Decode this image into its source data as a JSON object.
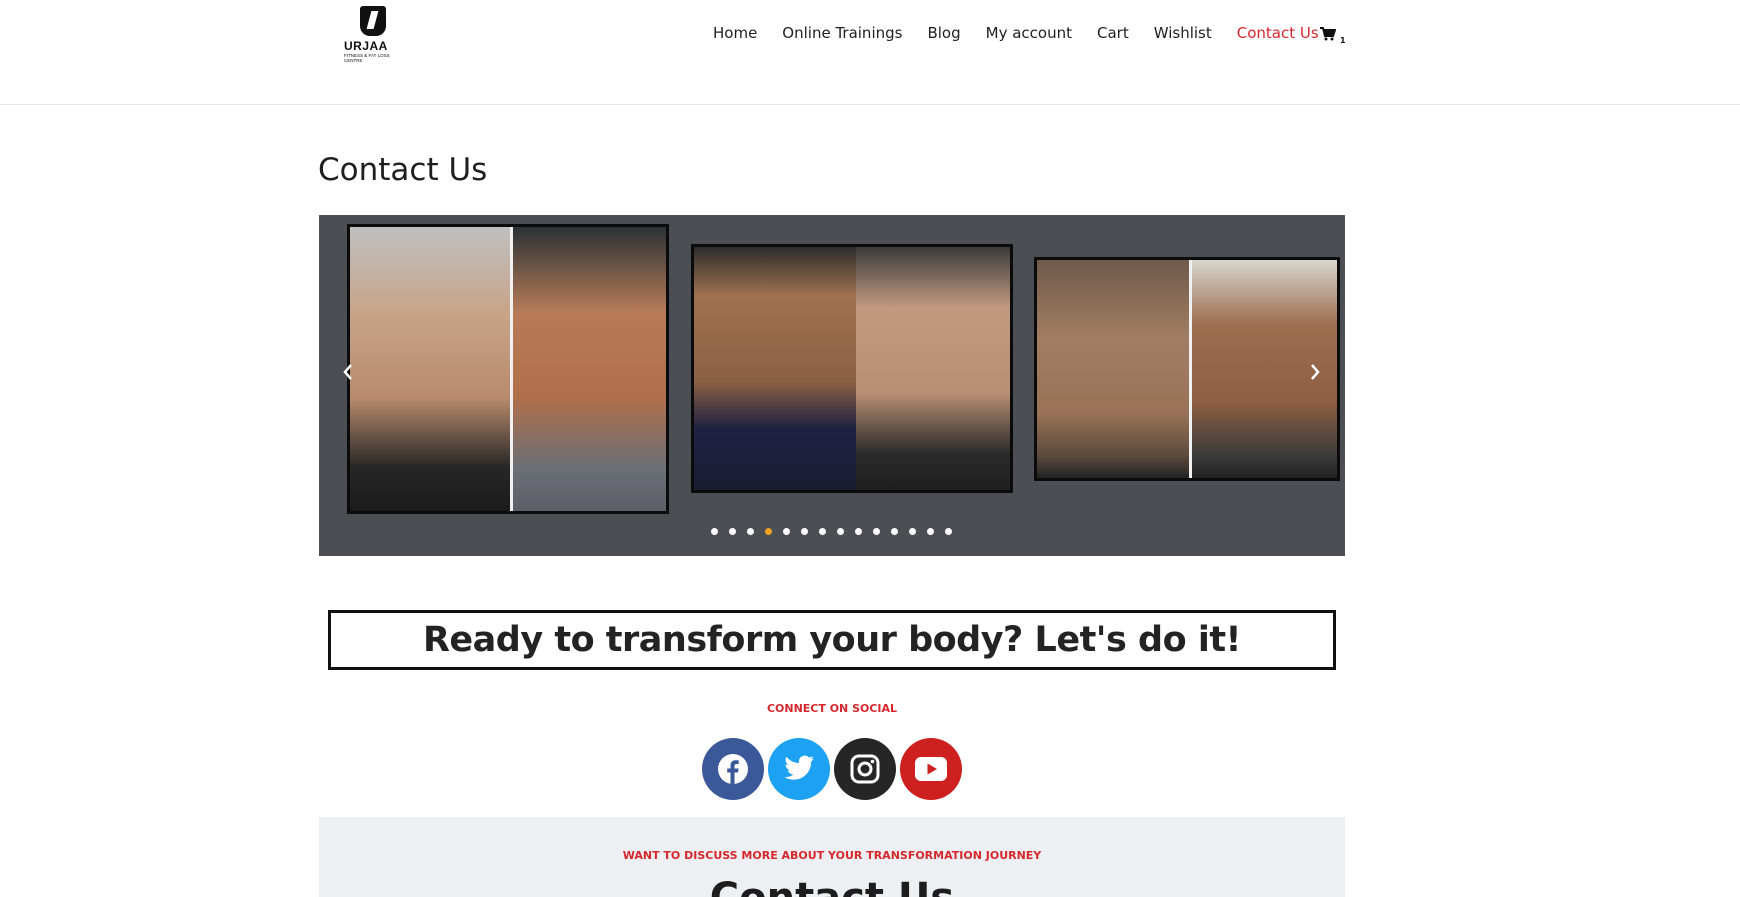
{
  "header": {
    "logo": {
      "brand": "URJAA",
      "tagline": "FITNESS & FAT LOSS CENTRE"
    },
    "nav": [
      {
        "label": "Home"
      },
      {
        "label": "Online Trainings"
      },
      {
        "label": "Blog"
      },
      {
        "label": "My account"
      },
      {
        "label": "Cart"
      },
      {
        "label": "Wishlist"
      },
      {
        "label": "Contact Us",
        "active": true
      }
    ],
    "cart": {
      "icon": "cart-icon",
      "count": "1"
    }
  },
  "page": {
    "title": "Contact Us"
  },
  "carousel": {
    "prev_icon": "chevron-left-icon",
    "next_icon": "chevron-right-icon",
    "dot_count": 14,
    "active_dot": 4
  },
  "cta": {
    "heading": "Ready to transform your body? Let's do it!"
  },
  "social": {
    "label": "CONNECT ON SOCIAL",
    "links": [
      {
        "icon": "facebook-icon",
        "color": "#3b5998"
      },
      {
        "icon": "twitter-icon",
        "color": "#1da1f2"
      },
      {
        "icon": "instagram-icon",
        "color": "#262626"
      },
      {
        "icon": "youtube-icon",
        "color": "#cd201f"
      }
    ]
  },
  "contact": {
    "label": "WANT TO DISCUSS MORE ABOUT YOUR TRANSFORMATION JOURNEY",
    "heading": "Contact Us"
  },
  "colors": {
    "accent": "#d6282c",
    "carousel_bg": "#4b4f53",
    "active_dot": "#f0a21f"
  }
}
